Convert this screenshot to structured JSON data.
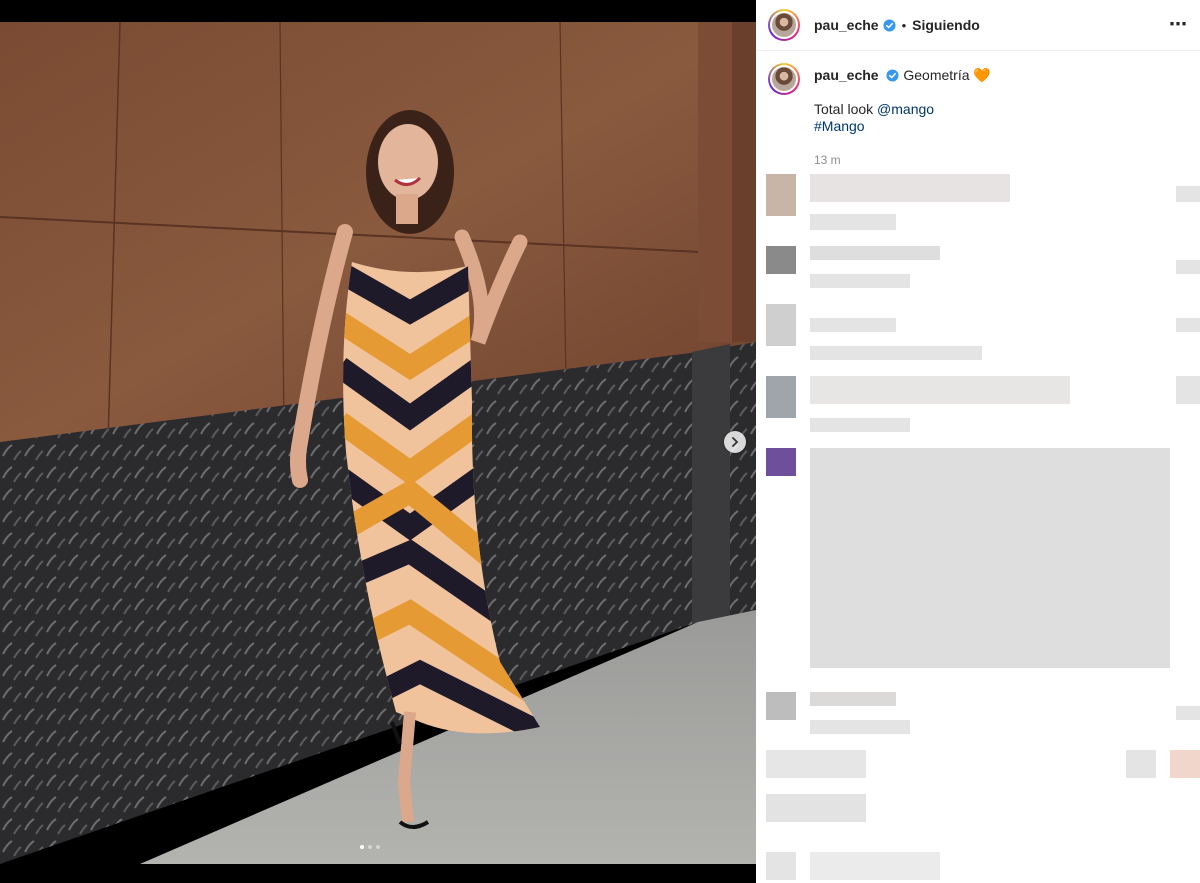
{
  "post": {
    "username": "pau_eche",
    "separator": "•",
    "follow_status": "Siguiendo",
    "more_icon": "more-horizontal-icon",
    "caption_title": "Geometría",
    "caption_emoji": "🧡",
    "caption_line_prefix": "Total look ",
    "caption_mention": "@mango",
    "caption_hashtag": "#Mango",
    "timestamp": "13 m"
  },
  "carousel": {
    "total_images": 3,
    "current_index": 1,
    "next_icon": "chevron-right-icon"
  },
  "colors": {
    "verified": "#3897f0",
    "link": "#00376b",
    "muted": "#8e8e8e",
    "text": "#262626"
  }
}
